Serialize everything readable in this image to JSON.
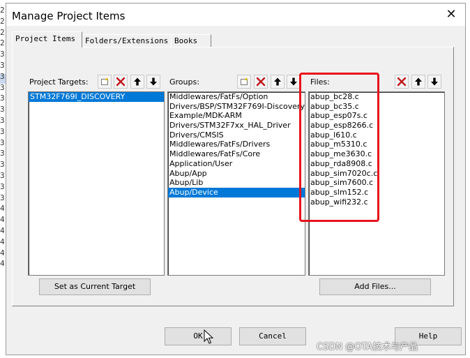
{
  "window": {
    "title": "Manage Project Items",
    "close_glyph": "✕"
  },
  "tabs": [
    {
      "label": "Project Items",
      "active": true
    },
    {
      "label": "Folders/Extensions",
      "active": false
    },
    {
      "label": "Books",
      "active": false
    }
  ],
  "targets": {
    "label": "Project Targets:",
    "items": [
      "STM32F769I_DISCOVERY"
    ],
    "selected_index": 0,
    "set_current_label": "Set as Current Target"
  },
  "groups": {
    "label": "Groups:",
    "items": [
      "Middlewares/FatFs/Option",
      "Drivers/BSP/STM32F769I-Discovery",
      "Example/MDK-ARM",
      "Drivers/STM32F7xx_HAL_Driver",
      "Drivers/CMSIS",
      "Middlewares/FatFs/Drivers",
      "Middlewares/FatFs/Core",
      "Application/User",
      "Abup/App",
      "Abup/Lib",
      "Abup/Device"
    ],
    "selected_index": 10
  },
  "files": {
    "label": "Files:",
    "items": [
      "abup_bc28.c",
      "abup_bc35.c",
      "abup_esp07s.c",
      "abup_esp8266.c",
      "abup_l610.c",
      "abup_m5310.c",
      "abup_me3630.c",
      "abup_rda8908.c",
      "abup_sim7020c.c",
      "abup_sim7600.c",
      "abup_slm152.c",
      "abup_wifi232.c"
    ],
    "add_files_label": "Add Files..."
  },
  "footer": {
    "ok": "OK",
    "cancel": "Cancel",
    "help": "Help"
  },
  "watermark": "CSDN @OTA技术与产品",
  "colors": {
    "selection": "#0078d7",
    "annotation_box": "#e8121b",
    "delete_icon": "#c0151b"
  },
  "background_digits": [
    "2",
    "2",
    "2",
    "2",
    "3",
    "3",
    "3",
    "3",
    "3",
    "3",
    "3",
    "3",
    "3",
    "3",
    "3",
    "3",
    "3",
    "3",
    "4",
    "4",
    "4",
    "4",
    "4",
    "4"
  ]
}
